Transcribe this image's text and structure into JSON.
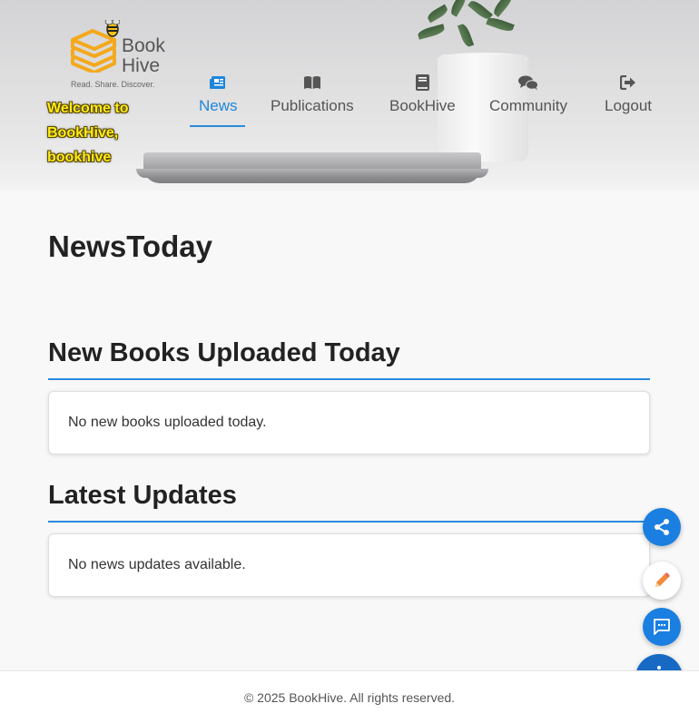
{
  "brand": {
    "name_line1": "Book",
    "name_line2": "Hive",
    "tagline": "Read. Share. Discover.",
    "welcome": "Welcome to BookHive, bookhive"
  },
  "nav": {
    "items": [
      {
        "label": "News",
        "icon": "newspaper-icon",
        "active": true
      },
      {
        "label": "Publications",
        "icon": "open-book-icon",
        "active": false
      },
      {
        "label": "BookHive",
        "icon": "book-icon",
        "active": false
      },
      {
        "label": "Community",
        "icon": "chat-bubbles-icon",
        "active": false
      },
      {
        "label": "Logout",
        "icon": "sign-out-icon",
        "active": false
      }
    ]
  },
  "page": {
    "title": "NewsToday"
  },
  "sections": [
    {
      "title": "New Books Uploaded Today",
      "message": "No new books uploaded today."
    },
    {
      "title": "Latest Updates",
      "message": "No news updates available."
    }
  ],
  "fabs": [
    {
      "name": "share-icon"
    },
    {
      "name": "pencil-icon"
    },
    {
      "name": "message-icon"
    },
    {
      "name": "robot-icon"
    }
  ],
  "footer": {
    "text": "© 2025 BookHive. All rights reserved."
  },
  "colors": {
    "accent": "#1f86d9",
    "welcome": "#ffea1a",
    "fab_blue": "#1a7fe0",
    "robot": "#1769c4"
  }
}
